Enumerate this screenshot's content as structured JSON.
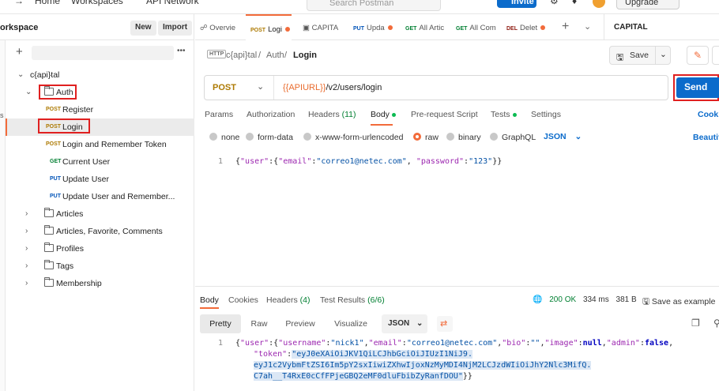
{
  "topbar": {
    "home": "Home",
    "workspaces": "Workspaces",
    "api_network": "API Network",
    "search_placeholder": "Search Postman",
    "invite": "Invite",
    "upgrade": "Upgrade"
  },
  "sidebar": {
    "workspace_title": "orkspace",
    "new_label": "New",
    "import_label": "Import",
    "rail_letter": "s",
    "collection": "c{api}tal",
    "items": [
      {
        "type": "folder",
        "label": "Auth",
        "expanded": true
      },
      {
        "type": "request",
        "method": "POST",
        "label": "Register"
      },
      {
        "type": "request",
        "method": "POST",
        "label": "Login",
        "selected": true
      },
      {
        "type": "request",
        "method": "POST",
        "label": "Login and Remember Token"
      },
      {
        "type": "request",
        "method": "GET",
        "label": "Current User"
      },
      {
        "type": "request",
        "method": "PUT",
        "label": "Update User"
      },
      {
        "type": "request",
        "method": "PUT",
        "label": "Update User and Remember..."
      },
      {
        "type": "folder",
        "label": "Articles"
      },
      {
        "type": "folder",
        "label": "Articles, Favorite, Comments"
      },
      {
        "type": "folder",
        "label": "Profiles"
      },
      {
        "type": "folder",
        "label": "Tags"
      },
      {
        "type": "folder",
        "label": "Membership"
      }
    ]
  },
  "tabs": {
    "items": [
      {
        "method": "",
        "label": "Overvie"
      },
      {
        "method": "POST",
        "label": "Logi",
        "dot": true
      },
      {
        "method": "",
        "label": "CAPITA"
      },
      {
        "method": "PUT",
        "label": "Upda",
        "dot": true
      },
      {
        "method": "GET",
        "label": "All Artic"
      },
      {
        "method": "GET",
        "label": "All Com"
      },
      {
        "method": "DEL",
        "label": "Delet",
        "dot": true
      }
    ],
    "add": "+",
    "environment": "CAPITAL"
  },
  "breadcrumb": {
    "badge": "HTTP",
    "collection": "c{api}tal",
    "sep": "/",
    "folder": "Auth",
    "request": "Login",
    "save": "Save"
  },
  "request": {
    "method": "POST",
    "url_var": "{{APIURL}}",
    "url_path": "/v2/users/login",
    "send": "Send"
  },
  "request_tabs": {
    "params": "Params",
    "authorization": "Authorization",
    "headers": "Headers",
    "headers_count": "(11)",
    "body": "Body",
    "prerequest": "Pre-request Script",
    "tests": "Tests",
    "settings": "Settings",
    "cookies": "Cooki"
  },
  "body_types": {
    "none": "none",
    "form_data": "form-data",
    "urlencoded": "x-www-form-urlencoded",
    "raw": "raw",
    "binary": "binary",
    "graphql": "GraphQL",
    "json": "JSON",
    "beautify": "Beautif"
  },
  "editor": {
    "line1_num": "1",
    "k_user": "\"user\"",
    "k_email": "\"email\"",
    "v_email": "\"correo1@netec.com\"",
    "k_password": "\"password\"",
    "v_password": "\"123\""
  },
  "response_tabs": {
    "body": "Body",
    "cookies": "Cookies",
    "headers": "Headers",
    "headers_count": "(4)",
    "test_results": "Test Results",
    "test_count": "(6/6)",
    "status": "200 OK",
    "time": "334 ms",
    "size": "381 B",
    "save_example": "Save as example"
  },
  "response_toolbar": {
    "pretty": "Pretty",
    "raw": "Raw",
    "preview": "Preview",
    "visualize": "Visualize",
    "format": "JSON"
  },
  "response": {
    "line1_num": "1",
    "k_user": "\"user\"",
    "k_username": "\"username\"",
    "v_username": "\"nick1\"",
    "k_email": "\"email\"",
    "v_email": "\"correo1@netec.com\"",
    "k_bio": "\"bio\"",
    "v_bio": "\"\"",
    "k_image": "\"image\"",
    "v_image": "null",
    "k_admin": "\"admin\"",
    "v_admin": "false",
    "k_token": "\"token\"",
    "token_part1": "\"eyJ0eXAiOiJKV1QiLCJhbGciOiJIUzI1NiJ9.",
    "token_part2": "eyJ1c2VybmFtZSI6Im5pY2sxIiwiZXhwIjoxNzMyMDI4NjM2LCJzdWIiOiJhY2Nlc3MifQ.",
    "token_part3": "C7ah__T4RxE0cCfFPjeGBQ2eMF0dluFbibZyRanfDOU\""
  }
}
